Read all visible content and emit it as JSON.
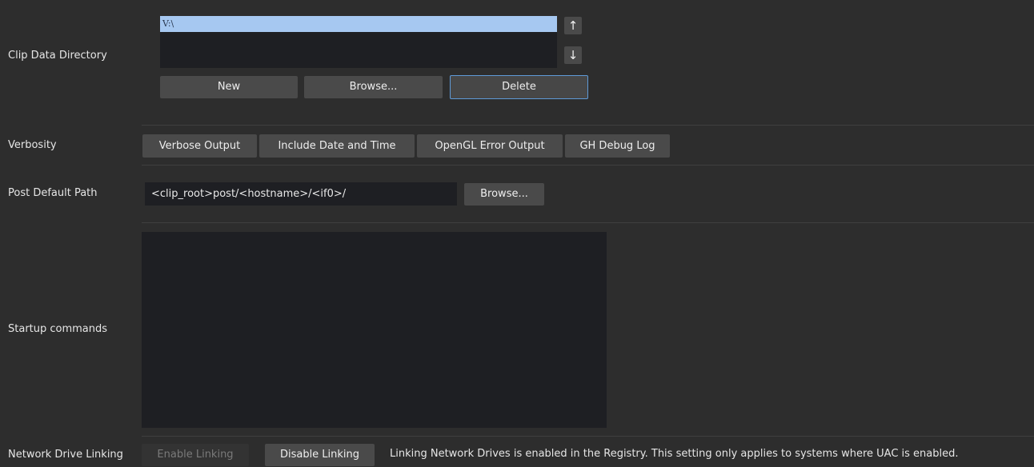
{
  "clip_data": {
    "label": "Clip Data Directory",
    "list_items": [
      "V:\\"
    ],
    "move_up_icon": "arrow-up-icon",
    "move_down_icon": "arrow-down-icon",
    "new_label": "New",
    "browse_label": "Browse...",
    "delete_label": "Delete"
  },
  "verbosity": {
    "label": "Verbosity",
    "options": [
      "Verbose Output",
      "Include Date and Time",
      "OpenGL Error Output",
      "GH Debug Log"
    ]
  },
  "post_default_path": {
    "label": "Post Default Path",
    "value": "<clip_root>post/<hostname>/<if0>/",
    "browse_label": "Browse..."
  },
  "startup_commands": {
    "label": "Startup commands",
    "value": ""
  },
  "network_drive_linking": {
    "label": "Network Drive Linking",
    "enable_label": "Enable Linking",
    "disable_label": "Disable Linking",
    "info_text": "Linking Network Drives is enabled in the Registry. This setting only applies to systems where UAC is enabled."
  },
  "colors": {
    "background": "#2d2d2d",
    "field_background": "#1e1f23",
    "button": "#4a4a4a",
    "selection": "#a6c8f1",
    "focus_border": "#5f9bd8"
  }
}
